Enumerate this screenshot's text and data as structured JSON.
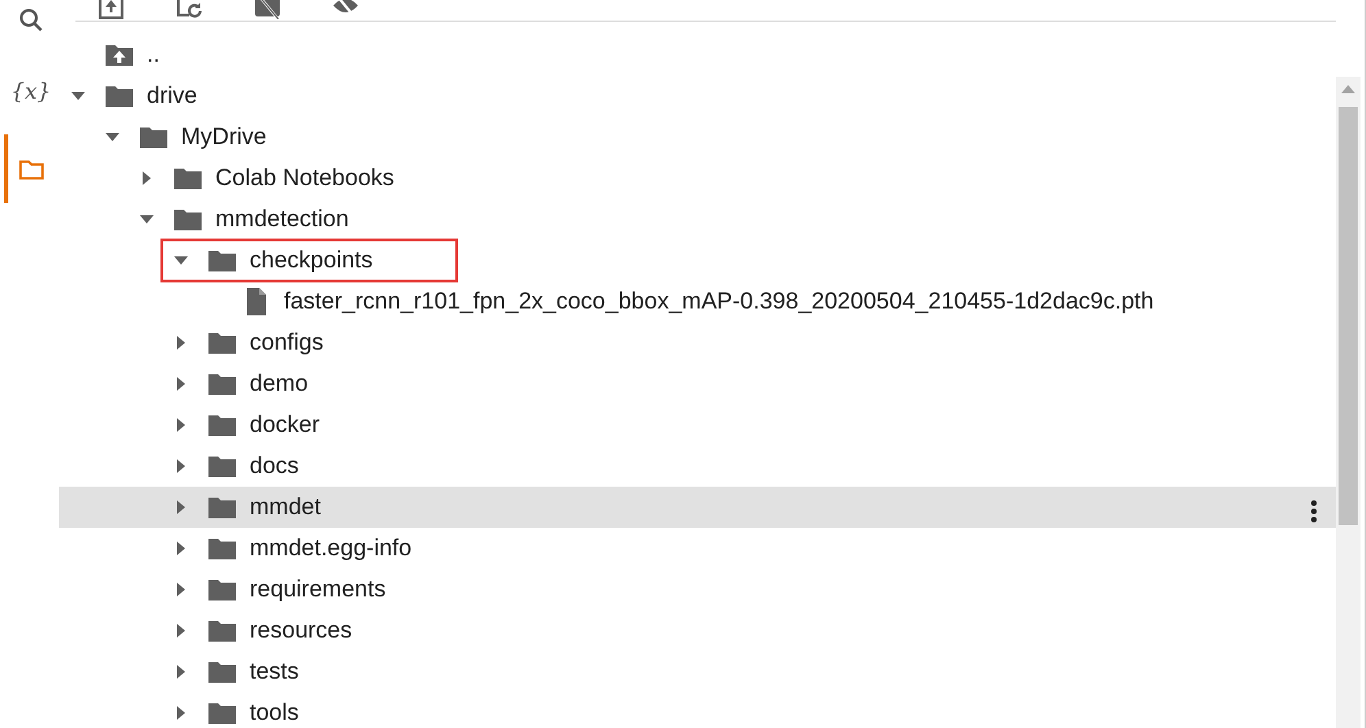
{
  "sidebar": {
    "items": [
      {
        "kind": "search",
        "selected": false
      },
      {
        "kind": "variables",
        "label": "{x}",
        "selected": false
      },
      {
        "kind": "files",
        "selected": true
      }
    ]
  },
  "toolbar": {
    "buttons": [
      {
        "kind": "upload"
      },
      {
        "kind": "refresh"
      },
      {
        "kind": "mount-drive"
      },
      {
        "kind": "hide"
      }
    ]
  },
  "tree": [
    {
      "kind": "parent",
      "name": ".."
    },
    {
      "kind": "folder",
      "name": "drive",
      "expanded": true,
      "children": [
        {
          "kind": "folder",
          "name": "MyDrive",
          "expanded": true,
          "children": [
            {
              "kind": "folder",
              "name": "Colab Notebooks",
              "expanded": false,
              "selected": false
            },
            {
              "kind": "folder",
              "name": "mmdetection",
              "expanded": true,
              "children": [
                {
                  "kind": "folder",
                  "name": "checkpoints",
                  "expanded": true,
                  "highlighted": true,
                  "children": [
                    {
                      "kind": "file",
                      "name": "faster_rcnn_r101_fpn_2x_coco_bbox_mAP-0.398_20200504_210455-1d2dac9c.pth",
                      "selected": false
                    }
                  ]
                },
                {
                  "kind": "folder",
                  "name": "configs",
                  "expanded": false,
                  "selected": false
                },
                {
                  "kind": "folder",
                  "name": "demo",
                  "expanded": false,
                  "selected": false
                },
                {
                  "kind": "folder",
                  "name": "docker",
                  "expanded": false,
                  "selected": false
                },
                {
                  "kind": "folder",
                  "name": "docs",
                  "expanded": false,
                  "selected": false
                },
                {
                  "kind": "folder",
                  "name": "mmdet",
                  "expanded": false,
                  "selected": true
                },
                {
                  "kind": "folder",
                  "name": "mmdet.egg-info",
                  "expanded": false,
                  "selected": false
                },
                {
                  "kind": "folder",
                  "name": "requirements",
                  "expanded": false,
                  "selected": false
                },
                {
                  "kind": "folder",
                  "name": "resources",
                  "expanded": false,
                  "selected": false
                },
                {
                  "kind": "folder",
                  "name": "tests",
                  "expanded": false,
                  "selected": false
                },
                {
                  "kind": "folder",
                  "name": "tools",
                  "expanded": false,
                  "selected": false
                }
              ]
            }
          ]
        }
      ]
    }
  ]
}
